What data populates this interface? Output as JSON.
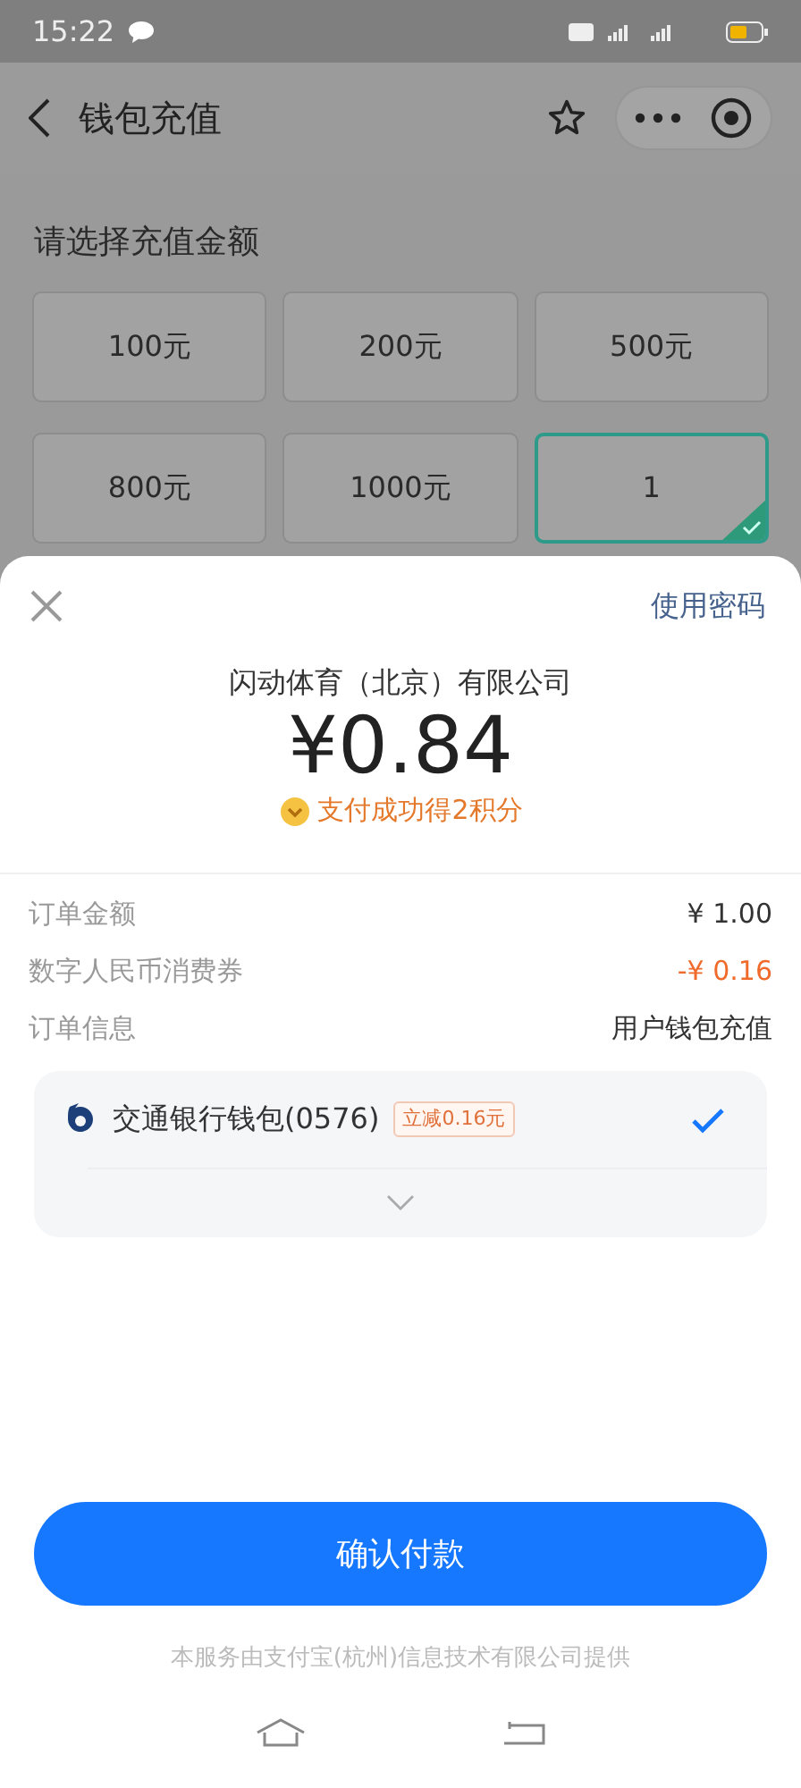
{
  "status_bar": {
    "time": "15:22"
  },
  "header": {
    "title": "钱包充值"
  },
  "section_title": "请选择充值金额",
  "amount_options": [
    {
      "label": "100元",
      "selected": false
    },
    {
      "label": "200元",
      "selected": false
    },
    {
      "label": "500元",
      "selected": false
    },
    {
      "label": "800元",
      "selected": false
    },
    {
      "label": "1000元",
      "selected": false
    },
    {
      "label": "1",
      "selected": true
    }
  ],
  "payment_sheet": {
    "password_link": "使用密码",
    "merchant": "闪动体育（北京）有限公司",
    "amount": "¥0.84",
    "reward": "支付成功得2积分",
    "details": [
      {
        "label": "订单金额",
        "value": "¥ 1.00",
        "kind": "normal"
      },
      {
        "label": "数字人民币消费券",
        "value": "-¥ 0.16",
        "kind": "discount"
      },
      {
        "label": "订单信息",
        "value": "用户钱包充值",
        "kind": "normal"
      }
    ],
    "method": {
      "name": "交通银行钱包(0576)",
      "tag": "立减0.16元",
      "selected": true
    },
    "confirm_button": "确认付款",
    "footer": "本服务由支付宝(杭州)信息技术有限公司提供"
  }
}
